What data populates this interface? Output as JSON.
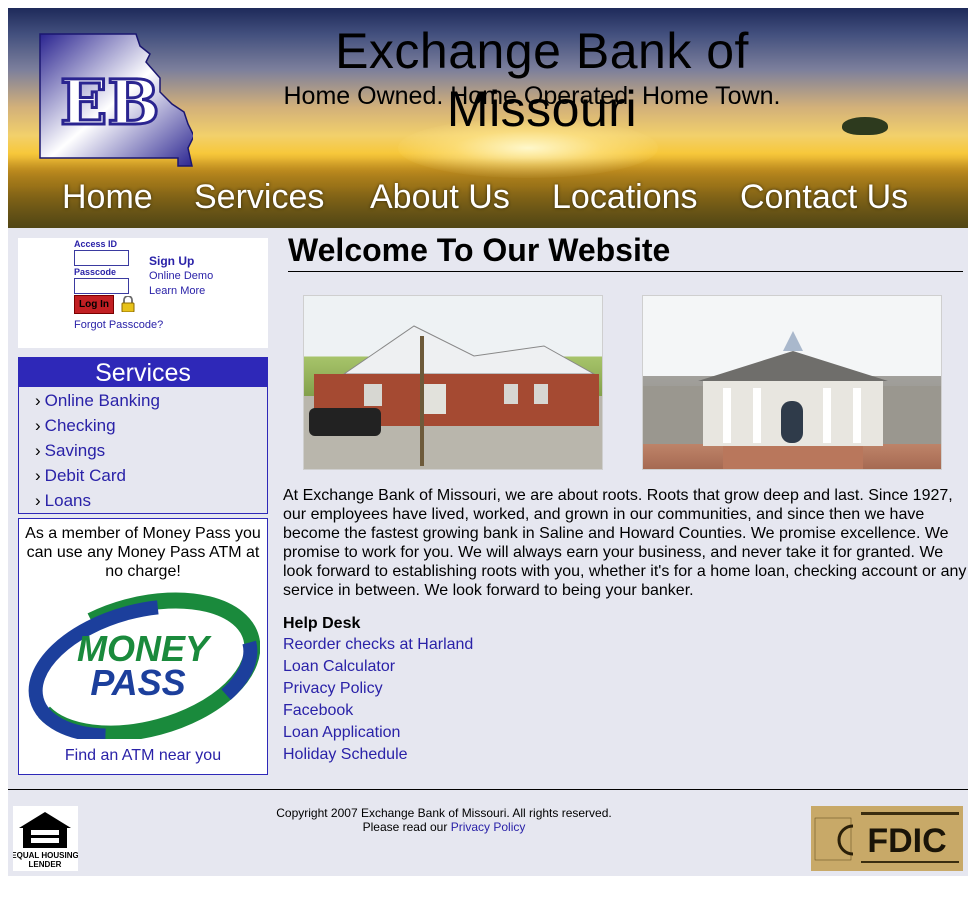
{
  "header": {
    "site_title": "Exchange Bank of Missouri",
    "tagline": "Home Owned. Home Operated. Home Town.",
    "logo_text": "EB"
  },
  "nav": {
    "items": [
      "Home",
      "Services",
      "About Us",
      "Locations",
      "Contact Us"
    ]
  },
  "login": {
    "access_id_label": "Access ID",
    "passcode_label": "Passcode",
    "login_button": "Log In",
    "forgot": "Forgot Passcode?",
    "sign_up": "Sign Up",
    "online_demo": "Online Demo",
    "learn_more": "Learn More"
  },
  "services": {
    "title": "Services",
    "items": [
      "Online Banking",
      "Checking",
      "Savings",
      "Debit Card",
      "Loans"
    ]
  },
  "moneypass": {
    "text": "As a member of Money Pass you can use any Money Pass ATM at no charge!",
    "logo_line1": "MONEY",
    "logo_line2": "PASS",
    "link": "Find an ATM near you"
  },
  "main": {
    "title": "Welcome To Our Website",
    "intro": "At Exchange Bank of Missouri, we are about roots. Roots that grow deep and last. Since 1927, our employees have lived, worked, and grown in our communities, and since then we have become the fastest growing bank in Saline and Howard Counties. We promise excellence. We promise to work for you. We will always earn your business, and never take it for granted. We look forward to establishing roots with you, whether it's for a home loan, checking account or any service in between. We look forward to being your banker.",
    "helpdesk_title": "Help Desk",
    "links": [
      "Reorder checks at Harland",
      "Loan Calculator",
      "Privacy Policy",
      "Facebook",
      "Loan Application",
      "Holiday Schedule"
    ]
  },
  "footer": {
    "copyright": "Copyright 2007 Exchange Bank of Missouri. All rights reserved.",
    "please_read": "Please read our",
    "privacy_link": "Privacy Policy",
    "eho_text1": "EQUAL HOUSING",
    "eho_text2": "LENDER",
    "fdic_text": "FDIC"
  },
  "colors": {
    "link": "#2a22a8",
    "services_header": "#2e28b8",
    "login_button": "#c21f23",
    "page_bg": "#e6e7f0"
  }
}
